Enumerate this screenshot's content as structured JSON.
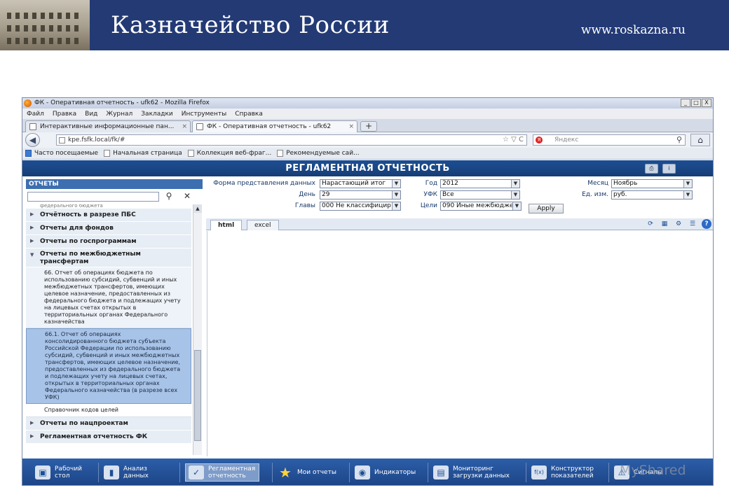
{
  "slide": {
    "title": "Казначейство России",
    "url": "www.roskazna.ru"
  },
  "browser": {
    "window_title": "ФК - Оперативная отчетность - ufk62 - Mozilla Firefox",
    "window_buttons": [
      "_",
      "□",
      "X"
    ],
    "menu": [
      "Файл",
      "Правка",
      "Вид",
      "Журнал",
      "Закладки",
      "Инструменты",
      "Справка"
    ],
    "tabs": [
      {
        "label": "Интерактивные информационные пан..."
      },
      {
        "label": "ФК - Оперативная отчетность - ufk62"
      }
    ],
    "tab_close": "×",
    "new_tab": "+",
    "address": "kpe.fsfk.local/fk/#",
    "address_right": "☆ ▽ C",
    "search_placeholder": "Яндекс",
    "search_engine": "Я",
    "bookmarks": [
      "Часто посещаемые",
      "Начальная страница",
      "Коллекция веб-фраг...",
      "Рекомендуемые сай..."
    ]
  },
  "app": {
    "title": "РЕГЛАМЕНТНАЯ ОТЧЕТНОСТЬ",
    "sidebar": {
      "header": "ОТЧЕТЫ",
      "cut_text": "федерального бюджета",
      "sections": [
        {
          "label": "Отчётность в разрезе ПБС",
          "expanded": false
        },
        {
          "label": "Отчеты для фондов",
          "expanded": false
        },
        {
          "label": "Отчеты по госпрограммам",
          "expanded": false
        },
        {
          "label": "Отчеты по межбюджетным трансфертам",
          "expanded": true
        }
      ],
      "items": [
        "66. Отчет об операциях бюджета по использованию субсидий, субвенций и иных межбюджетных трансфертов, имеющих целевое назначение, предоставленных из федерального бюджета и подлежащих учету на лицевых счетах открытых в территориальных органах Федерального казначейства",
        "66.1. Отчет об операциях консолидированного бюджета субъекта Российской Федерации по использованию субсидий, субвенций и иных межбюджетных трансфертов, имеющих целевое назначение, предоставленных из федерального бюджета и подлежащих учету на лицевых счетах, открытых в территориальных органах Федерального казначейства (в разрезе всех УФК)",
        "Справочник кодов целей"
      ],
      "after_sections": [
        "Отчеты по нацпроектам",
        "Регламентная отчетность ФК"
      ]
    },
    "filters": {
      "form_label": "Форма представления данных",
      "form_value": "Нарастающий итог",
      "day_label": "День",
      "day_value": "29",
      "chapters_label": "Главы",
      "chapters_value": "000 Не классифицир",
      "year_label": "Год",
      "year_value": "2012",
      "ufk_label": "УФК",
      "ufk_value": "Все",
      "goals_label": "Цели",
      "goals_value": "090 Иные межбюджет",
      "month_label": "Месяц",
      "month_value": "Ноябрь",
      "unit_label": "Ед. изм.",
      "unit_value": "руб.",
      "apply": "Apply"
    },
    "content_tabs": [
      "html",
      "excel"
    ],
    "taskbar": [
      {
        "label": "Рабочий стол",
        "icon": "monitor-icon"
      },
      {
        "label": "Анализ данных",
        "icon": "chart-icon"
      },
      {
        "label": "Регламентная отчетность",
        "icon": "checklist-icon",
        "active": true
      },
      {
        "label": "Мои отчеты",
        "icon": "star-icon"
      },
      {
        "label": "Индикаторы",
        "icon": "indicator-icon"
      },
      {
        "label": "Мониторинг загрузки данных",
        "icon": "server-icon"
      },
      {
        "label": "Конструктор показателей",
        "icon": "function-icon"
      },
      {
        "label": "Сигналы",
        "icon": "signal-icon"
      }
    ]
  },
  "watermark": "MyShared"
}
